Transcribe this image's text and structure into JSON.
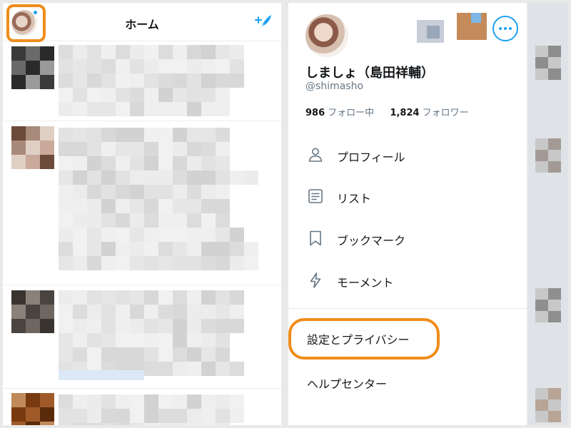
{
  "home": {
    "title": "ホーム"
  },
  "drawer": {
    "display_name": "しましょ（島田祥輔）",
    "handle": "@shimasho",
    "following_count": "986",
    "following_label": "フォロー中",
    "followers_count": "1,824",
    "followers_label": "フォロワー",
    "menu": [
      {
        "label": "プロフィール",
        "icon": "person-icon"
      },
      {
        "label": "リスト",
        "icon": "list-icon"
      },
      {
        "label": "ブックマーク",
        "icon": "bookmark-icon"
      },
      {
        "label": "モーメント",
        "icon": "lightning-icon"
      }
    ],
    "settings_label": "設定とプライバシー",
    "help_label": "ヘルプセンター"
  },
  "colors": {
    "accent": "#1da1f2",
    "highlight": "#f08c1a",
    "text": "#14171a",
    "muted": "#657786"
  }
}
